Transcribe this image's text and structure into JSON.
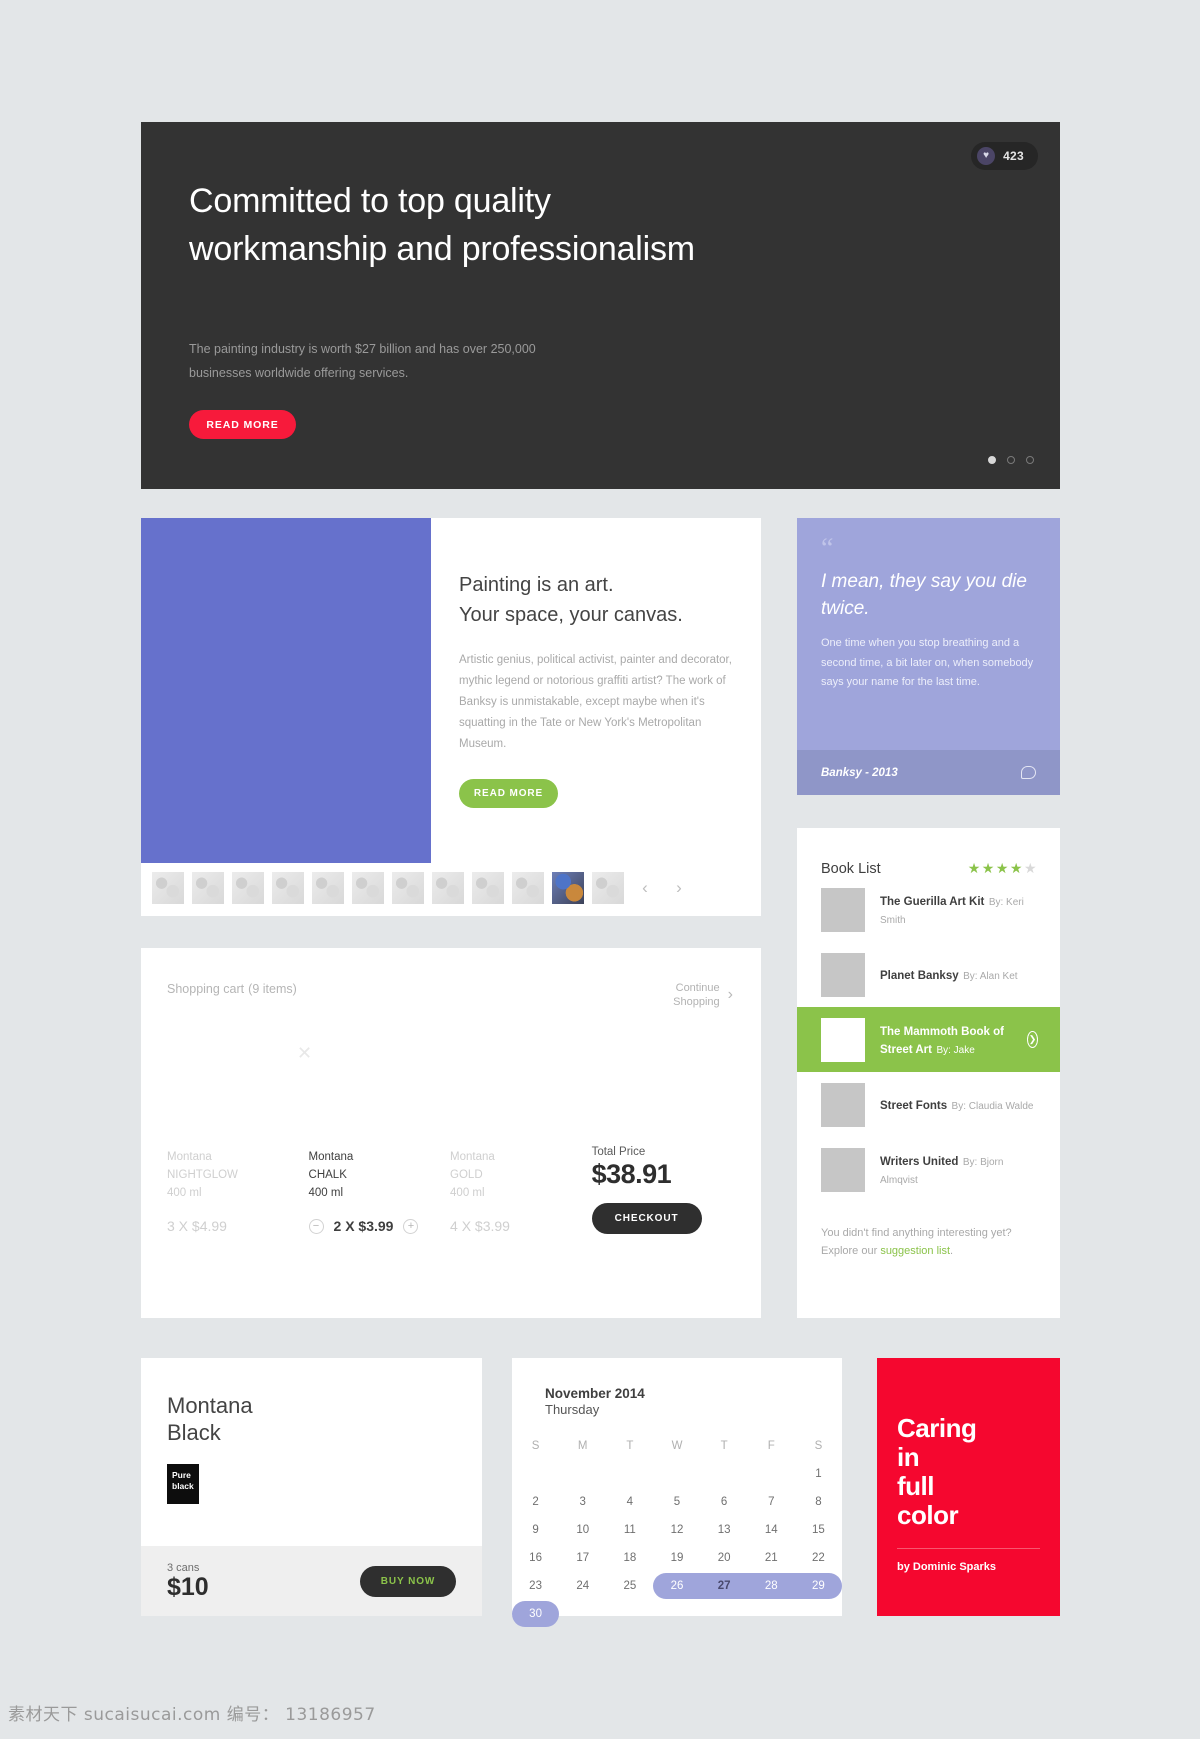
{
  "hero": {
    "badge_icon": "heart-icon",
    "badge_count": "423",
    "title": "Committed to top quality workmanship and professionalism",
    "subtitle": "The painting industry is worth $27 billion and has over 250,000 businesses worldwide offering services.",
    "cta_label": "READ MORE",
    "accent_color": "#f71a3b",
    "background_color": "#333333",
    "dots": 3,
    "active_dot": 1
  },
  "article": {
    "heading_line1": "Painting is an art.",
    "heading_line2": "Your space, your canvas.",
    "body": "Artistic genius, political activist, painter and decorator, mythic legend or notorious graffiti artist? The work of Banksy is unmistakable, except maybe when it's squatting in the Tate or New York's Metropolitan Museum.",
    "cta_label": "READ MORE",
    "image_color": "#6671cc",
    "accent_color": "#8bc34a",
    "thumbnail_count": 12,
    "selected_thumbnail": 11,
    "prev_icon": "chevron-left-icon",
    "next_icon": "chevron-right-icon"
  },
  "quote": {
    "quote_mark": "“",
    "text": "I mean, they say you die twice.",
    "body": "One time when you stop breathing and a second time, a bit later on, when somebody says your name for the last time.",
    "author": "Banksy - 2013",
    "comment_icon": "speech-bubble-icon",
    "body_color": "#9fa5db",
    "footer_color": "#8f96c8"
  },
  "books": {
    "title": "Book List",
    "rating": 4,
    "rating_max": 5,
    "star_color": "#8bc34a",
    "items": [
      {
        "title": "The Guerilla Art Kit",
        "author": "By: Keri Smith",
        "highlighted": false
      },
      {
        "title": "Planet Banksy",
        "author": "By: Alan Ket",
        "highlighted": false
      },
      {
        "title": "The Mammoth Book of Street Art",
        "author": "By: Jake",
        "highlighted": true,
        "go_icon": "arrow-right-circle-icon"
      },
      {
        "title": "Street Fonts",
        "author": "By: Claudia Walde",
        "highlighted": false
      },
      {
        "title": "Writers United",
        "author": "By: Bjorn Almqvist",
        "highlighted": false
      }
    ],
    "footer_text": "You didn't find anything interesting yet? Explore our ",
    "footer_link": "suggestion list",
    "footer_end": "."
  },
  "cart": {
    "title": "Shopping cart",
    "count_label": "(9 items)",
    "continue_label_line1": "Continue",
    "continue_label_line2": "Shopping",
    "continue_icon": "chevron-right-icon",
    "remove_icon": "close-icon",
    "items": [
      {
        "brand": "Montana",
        "name": "NIGHTGLOW",
        "size": "400 ml",
        "qty_line": "3 X $4.99",
        "active": false
      },
      {
        "brand": "Montana",
        "name": "CHALK",
        "size": "400 ml",
        "qty_line": "2 X $3.99",
        "active": true,
        "decrement_icon": "minus-circle-icon",
        "increment_icon": "plus-circle-icon"
      },
      {
        "brand": "Montana",
        "name": "GOLD",
        "size": "400 ml",
        "qty_line": "4 X $3.99",
        "active": false
      }
    ],
    "total_label": "Total Price",
    "total_value": "$38.91",
    "checkout_label": "CHECKOUT"
  },
  "product": {
    "name_line1": "Montana",
    "name_line2": "Black",
    "swatch_line1": "Pure",
    "swatch_line2": "black",
    "swatch_color": "#0d0d0d",
    "cans_label": "3 cans",
    "price": "$10",
    "buy_label": "BUY NOW",
    "buy_text_color": "#8bc34a"
  },
  "calendar": {
    "month": "November 2014",
    "weekday": "Thursday",
    "dow": [
      "S",
      "M",
      "T",
      "W",
      "T",
      "F",
      "S"
    ],
    "leading_blanks": 6,
    "days": [
      1,
      2,
      3,
      4,
      5,
      6,
      7,
      8,
      9,
      10,
      11,
      12,
      13,
      14,
      15,
      16,
      17,
      18,
      19,
      20,
      21,
      22,
      23,
      24,
      25,
      26,
      27,
      28,
      29,
      30
    ],
    "selected_days": [
      26,
      27,
      28,
      29,
      30
    ],
    "today": 27,
    "selection_color": "#9fa5db"
  },
  "poster": {
    "line1": "Caring",
    "line2": "in",
    "line3": "full",
    "line4": "color",
    "byline": "by Dominic Sparks",
    "background_color": "#f5072f"
  },
  "watermark": {
    "text": "素材天下 sucaisucai.com  编号： 13186957"
  }
}
